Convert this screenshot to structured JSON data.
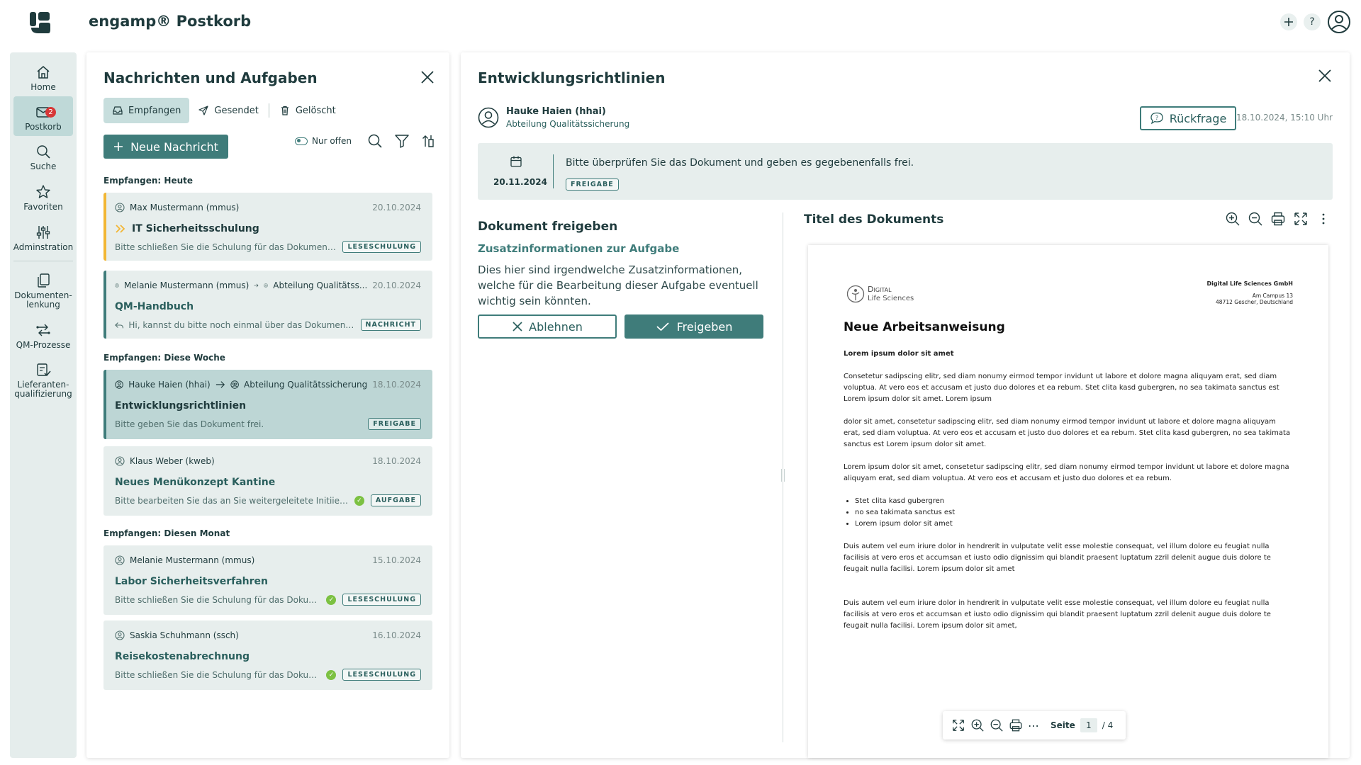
{
  "app": {
    "title": "engamp® Postkorb"
  },
  "topbar": {
    "add_icon": "plus-icon",
    "help_label": "?",
    "user_icon": "user-circle-icon"
  },
  "nav": {
    "items": [
      {
        "label": "Home",
        "icon": "home-icon"
      },
      {
        "label": "Postkorb",
        "icon": "mail-icon",
        "badge": "2"
      },
      {
        "label": "Suche",
        "icon": "search-icon"
      },
      {
        "label": "Favoriten",
        "icon": "star-icon"
      },
      {
        "label": "Adminstration",
        "icon": "sliders-icon"
      },
      {
        "label": "Dokumenten-\nlenkung",
        "icon": "documents-icon"
      },
      {
        "label": "QM-Prozesse",
        "icon": "process-icon"
      },
      {
        "label": "Lieferanten-\nqualifizierung",
        "icon": "supplier-icon"
      }
    ]
  },
  "messages": {
    "title": "Nachrichten und Aufgaben",
    "tabs": [
      {
        "label": "Empfangen",
        "icon": "inbox-icon"
      },
      {
        "label": "Gesendet",
        "icon": "send-icon"
      },
      {
        "label": "Gelöscht",
        "icon": "trash-icon"
      }
    ],
    "new_button": "Neue Nachricht",
    "filter_toggle": "Nur offen",
    "sections": [
      "Empfangen: Heute",
      "Empfangen: Diese Woche",
      "Empfangen: Diesen Monat"
    ],
    "cards": [
      {
        "sender": "Max Mustermann (mmus)",
        "date": "20.10.2024",
        "title": "IT Sicherheitsschulung",
        "text": "Bitte schließen Sie die Schulung für das Dokument ab.",
        "tag": "LESESCHULUNG"
      },
      {
        "sender": "Melanie Mustermann (mmus)",
        "recipient": "Abteilung Qualitätss...",
        "date": "20.10.2024",
        "title": "QM-Handbuch",
        "text": "Hi, kannst du bitte noch einmal über das Dokument drübe...",
        "tag": "NACHRICHT"
      },
      {
        "sender": "Hauke Haien (hhai)",
        "recipient": "Abteilung Qualitätssicherung",
        "date": "18.10.2024",
        "title": "Entwicklungsrichtlinien",
        "text": "Bitte geben Sie das Dokument frei.",
        "tag": "FREIGABE"
      },
      {
        "sender": "Klaus Weber (kweb)",
        "date": "18.10.2024",
        "title": "Neues Menükonzept Kantine",
        "text": "Bitte bearbeiten Sie das an Sie weitergeleitete Initiierungsf...",
        "tag": "AUFGABE"
      },
      {
        "sender": "Melanie Mustermann (mmus)",
        "date": "15.10.2024",
        "title": "Labor Sicherheitsverfahren",
        "text": "Bitte schließen Sie die Schulung für das Dokument ab.",
        "tag": "LESESCHULUNG"
      },
      {
        "sender": "Saskia Schuhmann (ssch)",
        "date": "16.10.2024",
        "title": "Reisekostenabrechnung",
        "text": "Bitte schließen Sie die Schulung für das Dokument ab.",
        "tag": "LESESCHULUNG"
      }
    ]
  },
  "detail": {
    "title": "Entwicklungsrichtlinien",
    "sender_name": "Hauke Haien (hhai)",
    "sender_dept": "Abteilung Qualitätssicherung",
    "query_button": "Rückfrage",
    "timestamp": "18.10.2024, 15:10 Uhr",
    "task": {
      "date": "20.11.2024",
      "text": "Bitte überprüfen Sie das Dokument und geben es gegebenenfalls frei.",
      "tag": "FREIGABE"
    },
    "approve_title": "Dokument freigeben",
    "info_title": "Zusatzinformationen zur Aufgabe",
    "info_text": "Dies hier sind irgendwelche Zusatzinformationen, welche für die Bearbeitung dieser Aufgabe eventuell wichtig sein könnten.",
    "reject_button": "Ablehnen",
    "approve_button": "Freigeben"
  },
  "viewer": {
    "title": "Titel des Dokuments",
    "page_label": "Seite",
    "page_current": "1",
    "page_total": "/ 4",
    "document": {
      "logo_line1": "Digital",
      "logo_line2": "Life Sciences",
      "company": "Digital Life Sciences GmbH",
      "address1": "Am Campus 13",
      "address2": "48712 Gescher, Deutschland",
      "heading": "Neue Arbeitsanweisung",
      "subheading": "Lorem ipsum dolor sit amet",
      "p1": "Consetetur sadipscing elitr, sed diam nonumy eirmod tempor invidunt ut labore et dolore magna aliquyam erat, sed diam voluptua. At vero eos et accusam et justo duo dolores et ea rebum. Stet clita kasd gubergren, no sea takimata sanctus est Lorem ipsum dolor sit amet. Lorem ipsum",
      "p2": "dolor sit amet, consetetur sadipscing elitr, sed diam nonumy eirmod tempor invidunt ut labore et dolore magna aliquyam erat, sed diam voluptua. At vero eos et accusam et justo duo dolores et ea rebum. Stet clita kasd gubergren, no sea takimata sanctus est Lorem ipsum dolor sit amet.",
      "p3": "Lorem ipsum dolor sit amet, consetetur sadipscing elitr, sed diam nonumy eirmod tempor invidunt ut labore et dolore magna aliquyam erat, sed diam voluptua. At vero eos et accusam et justo duo dolores et ea rebum.",
      "bullets": [
        "Stet clita kasd gubergren",
        "no sea takimata sanctus est",
        "Lorem ipsum dolor sit amet"
      ],
      "p4": "Duis autem vel eum iriure dolor in hendrerit in vulputate velit esse molestie consequat, vel illum dolore eu feugiat nulla facilisis at vero eros et accumsan et iusto odio dignissim qui blandit praesent luptatum zzril delenit augue duis dolore te feugait nulla facilisi. Lorem ipsum dolor sit amet",
      "p5": "Duis autem vel eum iriure dolor in hendrerit in vulputate velit esse molestie consequat, vel illum dolore eu feugiat nulla facilisis at vero eros et accumsan et iusto odio dignissim qui blandit praesent luptatum zzril delenit augue duis dolore te feugait nulla facilisi. Lorem ipsum dolor sit amet,"
    }
  },
  "colors": {
    "primary": "#3f7c7a",
    "primary_light": "#c7dedd",
    "card_bg": "#e7eeed",
    "nav_bg": "#e5edec",
    "badge": "#d73737",
    "unread_accent": "#f2b634",
    "done": "#7cc142"
  }
}
